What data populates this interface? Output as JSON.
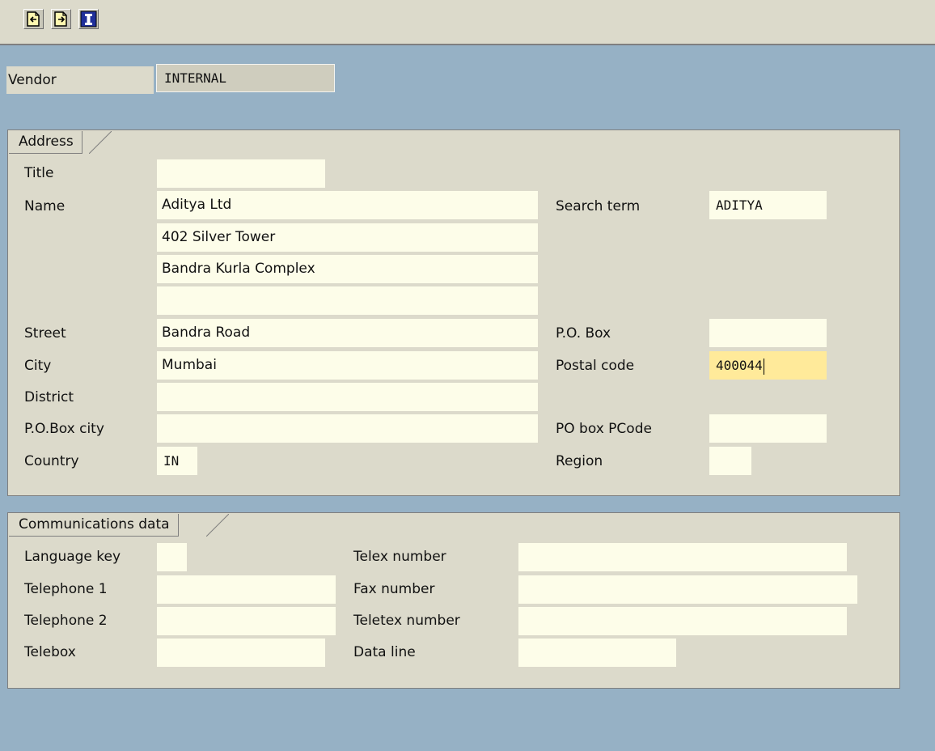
{
  "toolbar": {
    "buttons": [
      {
        "icon": "previous-screen-icon"
      },
      {
        "icon": "next-screen-icon"
      },
      {
        "icon": "info-icon"
      }
    ]
  },
  "vendor": {
    "label": "Vendor",
    "value": "INTERNAL"
  },
  "address": {
    "title": "Address",
    "labels": {
      "title": "Title",
      "name": "Name",
      "street": "Street",
      "city": "City",
      "district": "District",
      "po_box_city": "P.O.Box city",
      "country": "Country",
      "search_term": "Search term",
      "po_box": "P.O. Box",
      "postal_code": "Postal code",
      "po_box_pcode": "PO box PCode",
      "region": "Region"
    },
    "values": {
      "title": "",
      "name1": "Aditya Ltd",
      "name2": "402 Silver Tower",
      "name3": "Bandra Kurla Complex",
      "name4": "",
      "street": "Bandra Road",
      "city": "Mumbai",
      "district": "",
      "po_box_city": "",
      "country": "IN",
      "search_term": "ADITYA",
      "po_box": "",
      "postal_code": "400044",
      "po_box_pcode": "",
      "region": ""
    }
  },
  "communications": {
    "title": "Communications data",
    "labels": {
      "language_key": "Language key",
      "telephone1": "Telephone 1",
      "telephone2": "Telephone 2",
      "telebox": "Telebox",
      "telex_number": "Telex number",
      "fax_number": "Fax number",
      "teletex_number": "Teletex number",
      "data_line": "Data line"
    },
    "values": {
      "language_key": "",
      "telephone1": "",
      "telephone2": "",
      "telebox": "",
      "telex_number": "",
      "fax_number": "",
      "teletex_number": "",
      "data_line": ""
    }
  },
  "colors": {
    "background": "#96b1c5",
    "panel": "#dcdacb",
    "input": "#fdfde9",
    "focused_input": "#ffea9a"
  }
}
